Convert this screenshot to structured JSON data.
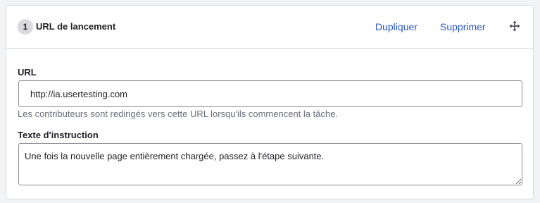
{
  "task": {
    "number": "1",
    "title": "URL de lancement",
    "actions": {
      "duplicate_label": "Dupliquer",
      "delete_label": "Supprimer",
      "move_icon": "move-icon"
    }
  },
  "url_field": {
    "label": "URL",
    "value": "http://ia.usertesting.com",
    "help_text": "Les contributeurs sont redirigés vers cette URL lorsqu'ils commencent la tâche."
  },
  "instruction_field": {
    "label": "Texte d'instruction",
    "value": "Une fois la nouvelle page entièrement chargée, passez à l'étape suivante."
  },
  "colors": {
    "link": "#2a56c6",
    "badge_bg": "#d9d9de",
    "border": "#dadbdf",
    "help_text": "#6b6e78"
  }
}
